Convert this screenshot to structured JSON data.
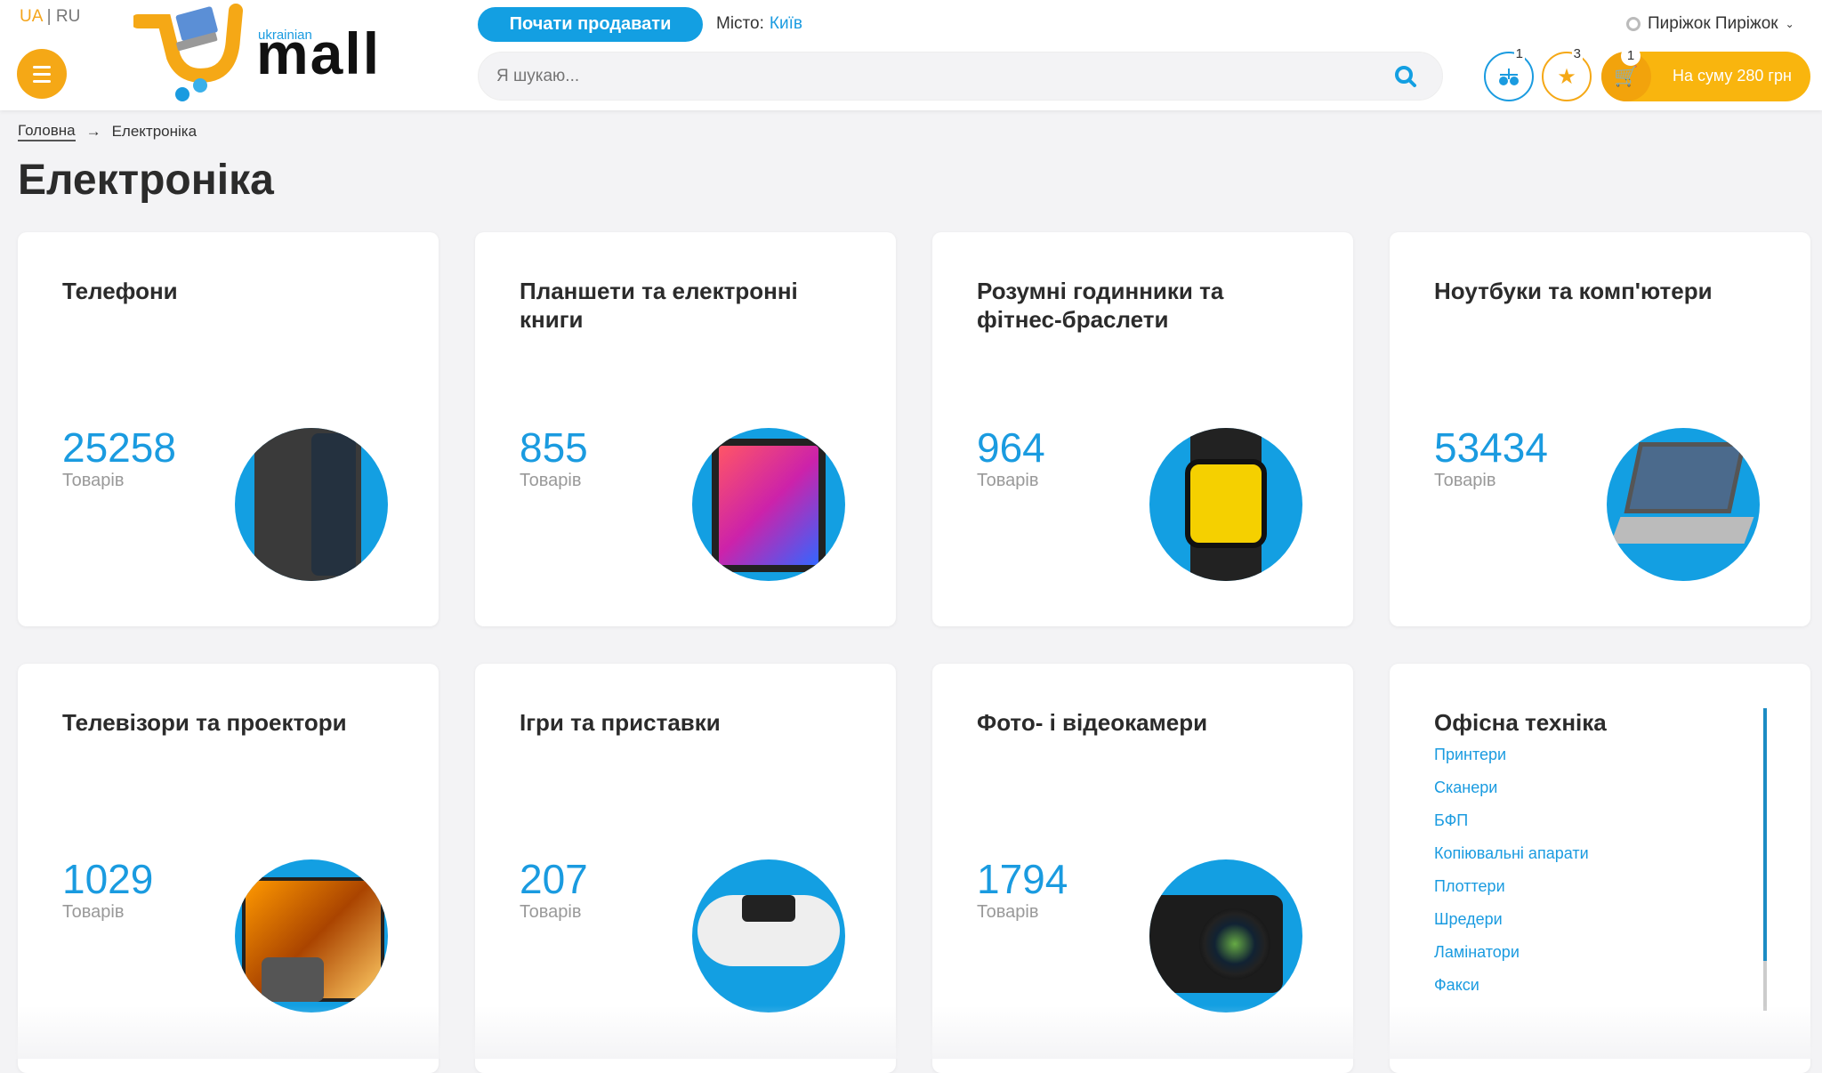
{
  "header": {
    "lang": {
      "active": "UA",
      "separator": "|",
      "other": "RU"
    },
    "logo": {
      "top": "ukrainian",
      "main": "mall"
    },
    "sell_button": "Почати продавати",
    "city_label": "Місто:",
    "city_value": "Київ",
    "search_placeholder": "Я шукаю...",
    "user_name": "Пиріжок Пиріжок",
    "compare_count": "1",
    "favorites_count": "3",
    "cart_count": "1",
    "cart_total": "На суму 280 грн"
  },
  "breadcrumb": {
    "home": "Головна",
    "current": "Електроніка"
  },
  "page_title": "Електроніка",
  "unit_label": "Товарів",
  "categories": [
    {
      "title": "Телефони",
      "count": "25258"
    },
    {
      "title": "Планшети та електронні книги",
      "count": "855"
    },
    {
      "title": "Розумні годинники та фітнес-браслети",
      "count": "964"
    },
    {
      "title": "Ноутбуки та комп'ютери",
      "count": "53434"
    },
    {
      "title": "Телевізори та проектори",
      "count": "1029"
    },
    {
      "title": "Ігри та приставки",
      "count": "207"
    },
    {
      "title": "Фото- і відеокамери",
      "count": "1794"
    }
  ],
  "office": {
    "title": "Офісна техніка",
    "links": [
      "Принтери",
      "Сканери",
      "БФП",
      "Копіювальні апарати",
      "Плоттери",
      "Шредери",
      "Ламінатори",
      "Факси"
    ]
  },
  "colors": {
    "accent_blue": "#139fe2",
    "accent_orange": "#f5a816"
  }
}
